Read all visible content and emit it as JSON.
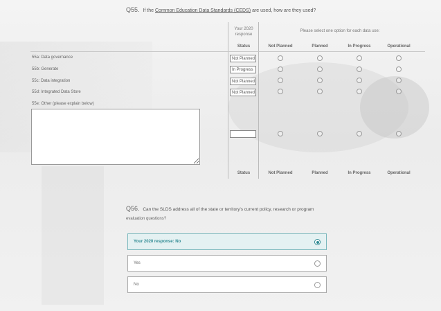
{
  "q55": {
    "number": "Q55.",
    "prefix": "If the",
    "link": "Common Education Data Standards (CEDS)",
    "suffix": "are used, how are they used?",
    "your_response_header": "Your 2020 response",
    "instruction": "Please select one option for each data use:",
    "columns": [
      "Status",
      "Not Planned",
      "Planned",
      "In Progress",
      "Operational"
    ],
    "rows": [
      {
        "label": "55a: Data governance",
        "status": "Not Planned"
      },
      {
        "label": "55b: Generate",
        "status": "In Progress"
      },
      {
        "label": "55c: Data integration",
        "status": "Not Planned"
      },
      {
        "label": "55d: Integrated Data Store",
        "status": "Not Planned"
      }
    ],
    "other_label": "55e: Other (please explain below)",
    "other_status": "",
    "footer_columns": [
      "Status",
      "Not Planned",
      "Planned",
      "In Progress",
      "Operational"
    ]
  },
  "q56": {
    "number": "Q56.",
    "text": "Can the SLDS address all of the state or territory's current policy, research or program",
    "text2": "evaluation questions?",
    "options": [
      {
        "label": "Your 2020 response: No",
        "selected": true
      },
      {
        "label": "Yes",
        "selected": false
      },
      {
        "label": "No",
        "selected": false
      }
    ]
  }
}
